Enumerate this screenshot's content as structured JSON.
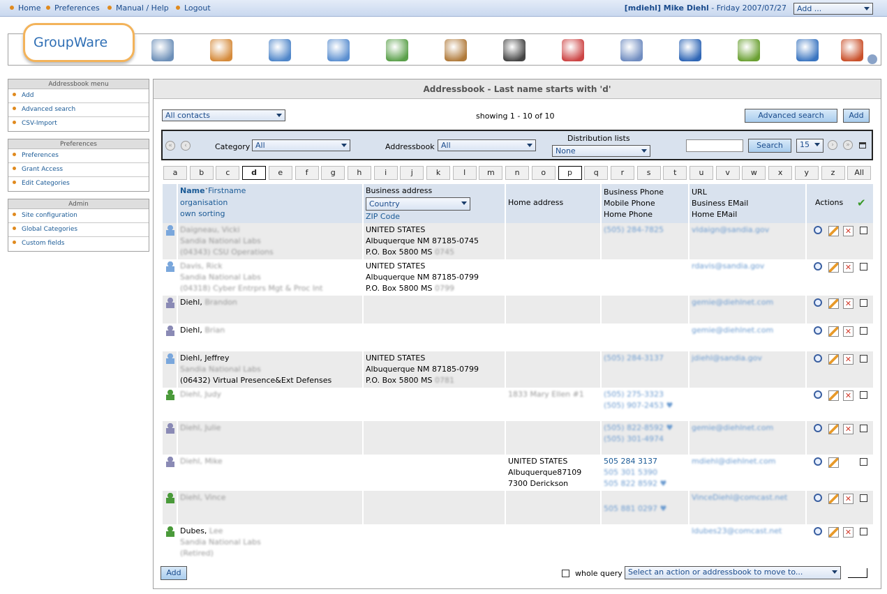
{
  "topnav": {
    "home": "Home",
    "preferences": "Preferences",
    "manual": "Manual / Help",
    "logout": "Logout"
  },
  "user": {
    "name": "[mdiehl] Mike Diehl",
    "date": " - Friday 2007/07/27",
    "add_select": "Add ..."
  },
  "logo": "GroupWare",
  "apps": [
    "admin",
    "home",
    "email",
    "calendar",
    "addressbook",
    "infolog",
    "projectmanager",
    "tracker",
    "timesheet",
    "wiki",
    "sitemgr",
    "knowledgebase",
    "logout"
  ],
  "sidebar": {
    "addressbook": {
      "title": "Addressbook menu",
      "items": [
        "Add",
        "Advanced search",
        "CSV-Import"
      ]
    },
    "preferences": {
      "title": "Preferences",
      "items": [
        "Preferences",
        "Grant Access",
        "Edit Categories"
      ]
    },
    "admin": {
      "title": "Admin",
      "items": [
        "Site configuration",
        "Global Categories",
        "Custom fields"
      ]
    }
  },
  "main": {
    "title": "Addressbook - Last name starts with 'd'",
    "contacts_select": "All contacts",
    "showing": "showing 1 - 10 of 10",
    "advanced_search": "Advanced search",
    "add": "Add",
    "filter": {
      "category_label": "Category",
      "category_value": "All",
      "addressbook_label": "Addressbook",
      "addressbook_value": "All",
      "distrib_label": "Distribution lists",
      "distrib_value": "None",
      "search_button": "Search",
      "page_size": "15"
    },
    "letters": [
      "a",
      "b",
      "c",
      "d",
      "e",
      "f",
      "g",
      "h",
      "i",
      "j",
      "k",
      "l",
      "m",
      "n",
      "o",
      "p",
      "q",
      "r",
      "s",
      "t",
      "u",
      "v",
      "w",
      "x",
      "y",
      "z",
      "All"
    ],
    "columns": {
      "name": "Name",
      "firstname": "Firstname",
      "organisation": "organisation",
      "own_sorting": "own sorting",
      "business_address": "Business address",
      "country": "Country",
      "zip": "ZIP Code",
      "home_address": "Home address",
      "bphone": "Business Phone",
      "mphone": "Mobile Phone",
      "hphone": "Home Phone",
      "url": "URL",
      "bemail": "Business EMail",
      "hemail": "Home EMail",
      "actions": "Actions"
    },
    "rows": [
      {
        "type": "single",
        "name": "Daigneau, Vicki",
        "org": "Sandia National Labs",
        "dept": "(04343) CSU Operations",
        "badd": [
          "UNITED STATES",
          "Albuquerque NM 87185-0745",
          "P.O. Box 5800 MS "
        ],
        "bms": "0745",
        "home": [],
        "phones": [
          "(505) 284-7825"
        ],
        "emails": [
          "vldaign@sandia.gov"
        ]
      },
      {
        "type": "single",
        "name": "Davis, Rick",
        "org": "Sandia National Labs",
        "dept": "(04318) Cyber Entrprs Mgt & Proc Int",
        "badd": [
          "UNITED STATES",
          "Albuquerque NM 87185-0799",
          "P.O. Box 5800 MS "
        ],
        "bms": "0799",
        "home": [],
        "phones": [],
        "emails": [
          "rdavis@sandia.gov"
        ]
      },
      {
        "type": "own",
        "name_clear": "Diehl, ",
        "name_blur": "Brandon",
        "org": "",
        "dept": "",
        "badd": [],
        "bms": "",
        "home": [],
        "phones": [],
        "emails": [
          "gemie@diehlnet.com"
        ]
      },
      {
        "type": "own",
        "name_clear": "Diehl, ",
        "name_blur": "Brian",
        "org": "",
        "dept": "",
        "badd": [],
        "bms": "",
        "home": [],
        "phones": [],
        "emails": [
          "gemie@diehlnet.com"
        ]
      },
      {
        "type": "single",
        "name_clear": "Diehl, Jeffrey",
        "org": "Sandia National Labs",
        "dept_clear": "(06432) Virtual Presence&Ext Defenses",
        "badd": [
          "UNITED STATES",
          "Albuquerque NM 87185-0799",
          "P.O. Box 5800 MS "
        ],
        "bms": "0781",
        "home": [],
        "phones": [
          "(505) 284-3137"
        ],
        "emails": [
          "jdiehl@sandia.gov"
        ]
      },
      {
        "type": "group",
        "name": "Diehl, Judy",
        "org": "",
        "dept": "",
        "badd": [],
        "bms": "",
        "home_blur": "1833 Mary Ellen #1",
        "phones": [
          "(505) 275-3323",
          "(505) 907-2453 ♥"
        ],
        "emails": []
      },
      {
        "type": "own",
        "name": "Diehl, Julie",
        "org": "",
        "dept": "",
        "badd": [],
        "bms": "",
        "home": [],
        "phones": [
          "(505) 822-8592 ♥",
          "(505) 301-4974"
        ],
        "emails": [
          "gemie@diehlnet.com"
        ]
      },
      {
        "type": "own",
        "name": "Diehl, Mike",
        "org": "",
        "dept": "",
        "badd": [],
        "bms": "",
        "home_clear": [
          "UNITED STATES",
          "Albuquerque87109",
          "7300 Derickson"
        ],
        "phones": [
          "505 284 3137",
          "505 301 5390",
          "505 822 8592 ♥"
        ],
        "emails": [
          "mdiehl@diehlnet.com"
        ]
      },
      {
        "type": "group",
        "name": "Diehl, Vince",
        "org": "",
        "dept": "",
        "badd": [],
        "bms": "",
        "home": [],
        "phones": [
          "505 881 0297 ♥"
        ],
        "emails": [
          "VinceDiehl@comcast.net"
        ]
      },
      {
        "type": "group",
        "name_clear": "Dubes, ",
        "name_blur": "Lee",
        "org": "Sandia National Labs",
        "dept": "(Retired)",
        "badd": [],
        "bms": "",
        "home": [],
        "phones": [],
        "emails": [
          "ldubes23@comcast.net"
        ]
      }
    ],
    "footer": {
      "add": "Add",
      "whole_query": "whole query",
      "action_select": "Select an action or addressbook to move to..."
    }
  }
}
